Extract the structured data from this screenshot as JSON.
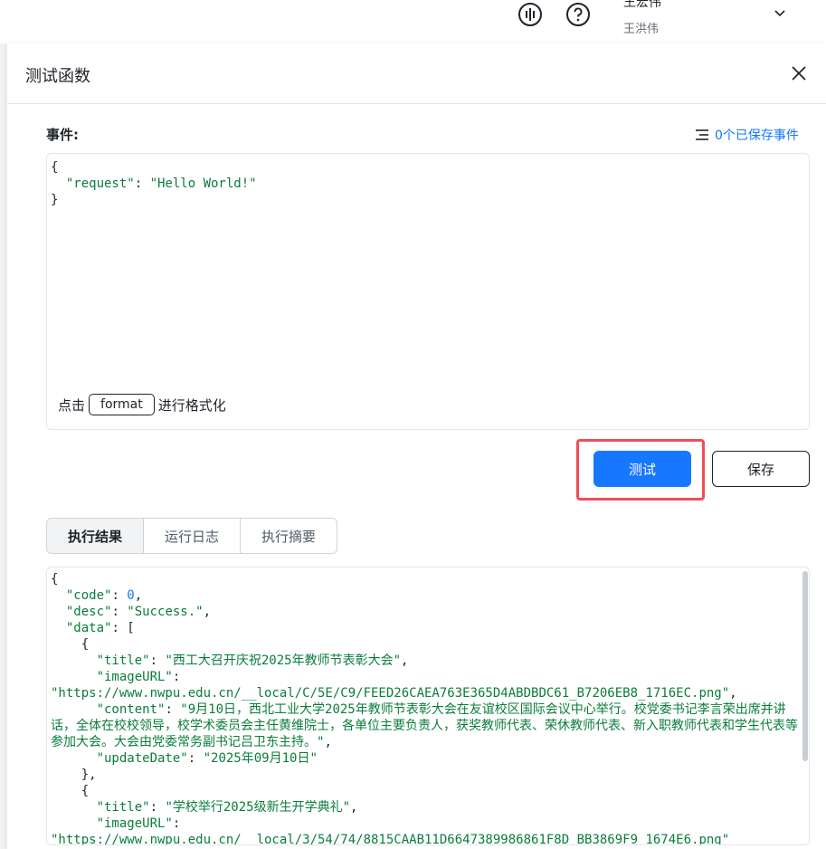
{
  "header": {
    "user_name": "王宏伟",
    "user_sub": "王洪伟",
    "icons": [
      "voice-icon",
      "help-icon",
      "chevron-down-icon"
    ]
  },
  "drawer": {
    "title": "测试函数",
    "event_label": "事件:",
    "saved_events_link": "0个已保存事件",
    "event_code": {
      "open": "{",
      "key": "\"request\"",
      "sep": ": ",
      "value": "\"Hello World!\"",
      "close": "}"
    },
    "format_hint_prefix": "点击",
    "format_button": "format",
    "format_hint_suffix": "进行格式化",
    "test_button": "测试",
    "save_button": "保存",
    "tabs": [
      "执行结果",
      "运行日志",
      "执行摘要"
    ],
    "active_tab": "执行结果",
    "result": {
      "l1": "{",
      "code_key": "\"code\"",
      "code_val": "0",
      "desc_key": "\"desc\"",
      "desc_val": "\"Success.\"",
      "data_key": "\"data\"",
      "data_open": "[",
      "item_open": "{",
      "title_key": "\"title\"",
      "title1": "\"西工大召开庆祝2025年教师节表彰大会\"",
      "image_key": "\"imageURL\"",
      "image1": "\"https://www.nwpu.edu.cn/__local/C/5E/C9/FEED26CAEA763E365D4ABDBDC61_B7206EB8_1716EC.png\"",
      "content_key": "\"content\"",
      "content1": "\"9月10日，西北工业大学2025年教师节表彰大会在友谊校区国际会议中心举行。校党委书记李言荣出席并讲话，全体在校校领导，校学术委员会主任黄维院士，各单位主要负责人，获奖教师代表、荣休教师代表、新入职教师代表和学生代表等参加大会。大会由党委常务副书记吕卫东主持。\"",
      "date_key": "\"updateDate\"",
      "date1": "\"2025年09月10日\"",
      "item_close": "},",
      "title2": "\"学校举行2025级新生开学典礼\"",
      "image2": "\"https://www.nwpu.edu.cn/__local/3/54/74/8815CAAB11D6647389986861F8D_BB3869F9_1674E6.png\""
    }
  }
}
